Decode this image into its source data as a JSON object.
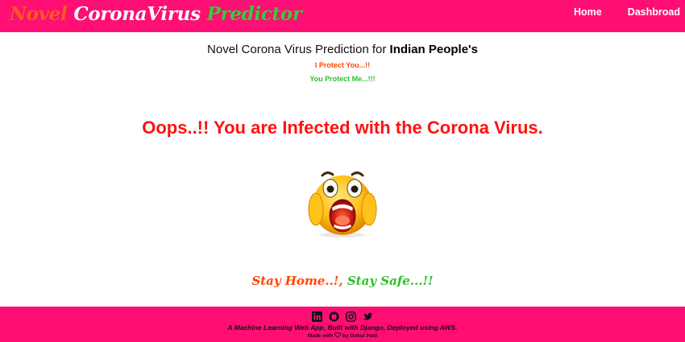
{
  "navbar": {
    "brand_word1": "Novel",
    "brand_word2": "CoronaVirus",
    "brand_word3": "Predictor",
    "links": [
      {
        "label": "Home"
      },
      {
        "label": "Dashbroad"
      }
    ],
    "bg_color": "#ff0f73"
  },
  "main": {
    "heading_prefix": "Novel Corona Virus Prediction for ",
    "heading_bold": "Indian People's",
    "tagline1": "I Protect You...!!",
    "tagline2": "You Protect Me...!!!",
    "result_text": "Oops..!! You are Infected with the Corona Virus.",
    "result_icon": "screaming-face-emoji",
    "stay_home": "Stay Home..!,",
    "stay_safe": "Stay Safe...!!"
  },
  "footer": {
    "social_icons": [
      "linkedin-icon",
      "github-icon",
      "instagram-icon",
      "twitter-icon"
    ],
    "line1": "A Machine Learning Web App, Built with Django, Deployed using AWS.",
    "made_with": "Made with",
    "by_author": "by Gokul Patil"
  },
  "colors": {
    "accent_pink": "#ff0f73",
    "orange": "#ff4500",
    "green": "#2fbf2f",
    "red": "#ff1111"
  }
}
